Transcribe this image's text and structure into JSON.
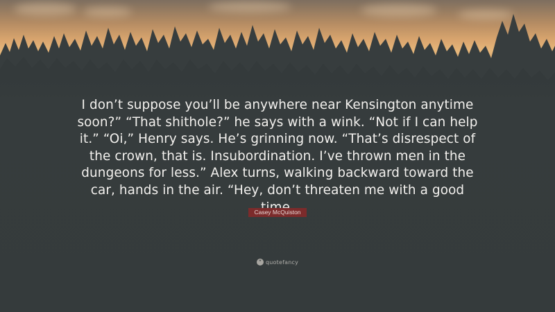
{
  "quote": {
    "text": "I don’t suppose you’ll be anywhere near Kensington anytime soon?” “That shithole?” he says with a wink. “Not if I can help it.” “Oi,” Henry says. He’s grinning now. “That’s disrespect of the crown, that is. Insubordination. I’ve thrown men in the dungeons for less.” Alex turns, walking backward toward the car, hands in the air. “Hey, don’t threaten me with a good time.",
    "author": "Casey McQuiston"
  },
  "brand": {
    "name": "quotefancy",
    "icon": "quote-mark-icon"
  },
  "colors": {
    "background": "#363c3d",
    "sky_warm": "#e7b77a",
    "author_badge": "#7c2b2b",
    "text": "#f3f1ee"
  }
}
